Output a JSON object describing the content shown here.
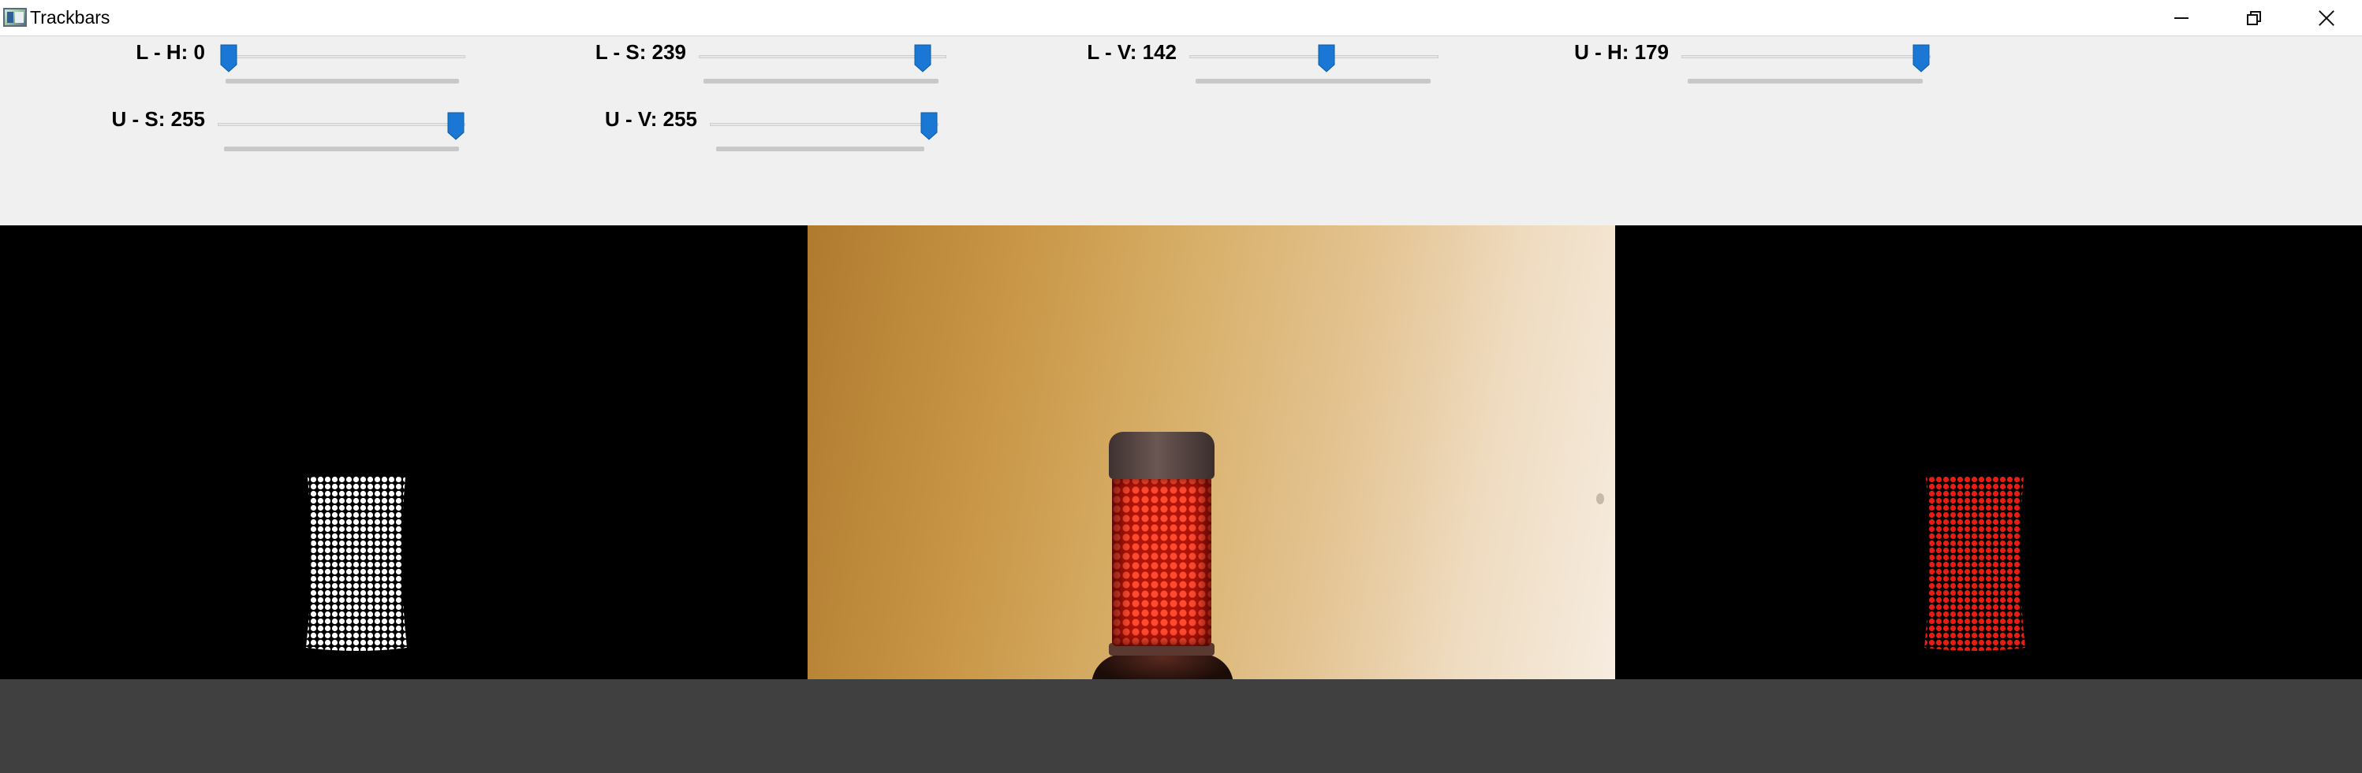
{
  "window": {
    "title": "Trackbars",
    "icon": "app-window-icon",
    "buttons": [
      "minimize-icon",
      "restore-icon",
      "close-icon"
    ]
  },
  "trackbars": [
    {
      "id": "lh",
      "name": "L - H",
      "value": 0,
      "max": 179,
      "label": "L - H: 0"
    },
    {
      "id": "ls",
      "name": "L - S",
      "value": 239,
      "max": 255,
      "label": "L - S: 239"
    },
    {
      "id": "lv",
      "name": "L - V",
      "value": 142,
      "max": 255,
      "label": "L - V: 142"
    },
    {
      "id": "uh",
      "name": "U - H",
      "value": 179,
      "max": 179,
      "label": "U - H: 179"
    },
    {
      "id": "us",
      "name": "U - S",
      "value": 255,
      "max": 255,
      "label": "U - S: 255"
    },
    {
      "id": "uv",
      "name": "U - V",
      "value": 255,
      "max": 255,
      "label": "U - V: 255"
    }
  ],
  "colors": {
    "thumb": "#1a78d4",
    "panel": "#f0f0f0",
    "mask_fg": "#ffffff",
    "result_fg": "#e81c10",
    "bottom": "#404040"
  },
  "views": [
    {
      "name": "mask",
      "description_icon": "binary-mask-image"
    },
    {
      "name": "frame",
      "description_icon": "camera-frame-image"
    },
    {
      "name": "result",
      "description_icon": "masked-result-image"
    }
  ]
}
